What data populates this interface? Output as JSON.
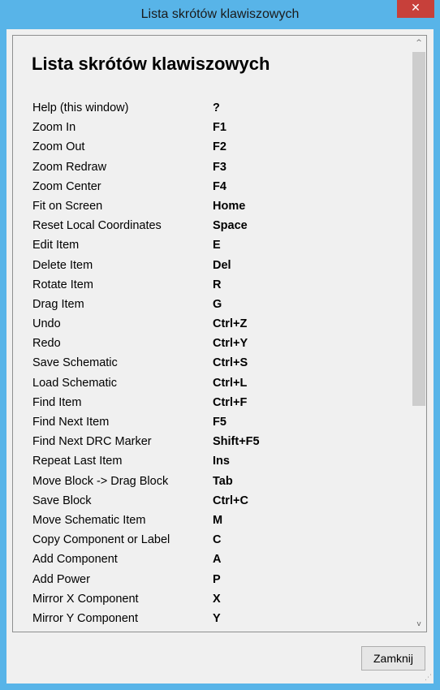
{
  "window": {
    "title": "Lista skrótów klawiszowych",
    "close_glyph": "✕"
  },
  "heading": "Lista skrótów klawiszowych",
  "shortcuts": [
    {
      "action": "Help (this window)",
      "key": "?"
    },
    {
      "action": "Zoom In",
      "key": "F1"
    },
    {
      "action": "Zoom Out",
      "key": "F2"
    },
    {
      "action": "Zoom Redraw",
      "key": "F3"
    },
    {
      "action": "Zoom Center",
      "key": "F4"
    },
    {
      "action": "Fit on Screen",
      "key": "Home"
    },
    {
      "action": "Reset Local Coordinates",
      "key": "Space"
    },
    {
      "action": "Edit Item",
      "key": "E"
    },
    {
      "action": "Delete Item",
      "key": "Del"
    },
    {
      "action": "Rotate Item",
      "key": "R"
    },
    {
      "action": "Drag Item",
      "key": "G"
    },
    {
      "action": "Undo",
      "key": "Ctrl+Z"
    },
    {
      "action": "Redo",
      "key": "Ctrl+Y"
    },
    {
      "action": "Save Schematic",
      "key": "Ctrl+S"
    },
    {
      "action": "Load Schematic",
      "key": "Ctrl+L"
    },
    {
      "action": "Find Item",
      "key": "Ctrl+F"
    },
    {
      "action": "Find Next Item",
      "key": "F5"
    },
    {
      "action": "Find Next DRC Marker",
      "key": "Shift+F5"
    },
    {
      "action": "Repeat Last Item",
      "key": "Ins"
    },
    {
      "action": "Move Block -> Drag Block",
      "key": "Tab"
    },
    {
      "action": "Save Block",
      "key": "Ctrl+C"
    },
    {
      "action": "Move Schematic Item",
      "key": "M"
    },
    {
      "action": "Copy Component or Label",
      "key": "C"
    },
    {
      "action": "Add Component",
      "key": "A"
    },
    {
      "action": "Add Power",
      "key": "P"
    },
    {
      "action": "Mirror X Component",
      "key": "X"
    },
    {
      "action": "Mirror Y Component",
      "key": "Y"
    }
  ],
  "scrollbar": {
    "up_glyph": "^",
    "down_glyph": "v"
  },
  "footer": {
    "close_button_label": "Zamknij"
  },
  "colors": {
    "titlebar": "#58b4e8",
    "close_button": "#c7403a",
    "client_bg": "#f0f0f0"
  }
}
